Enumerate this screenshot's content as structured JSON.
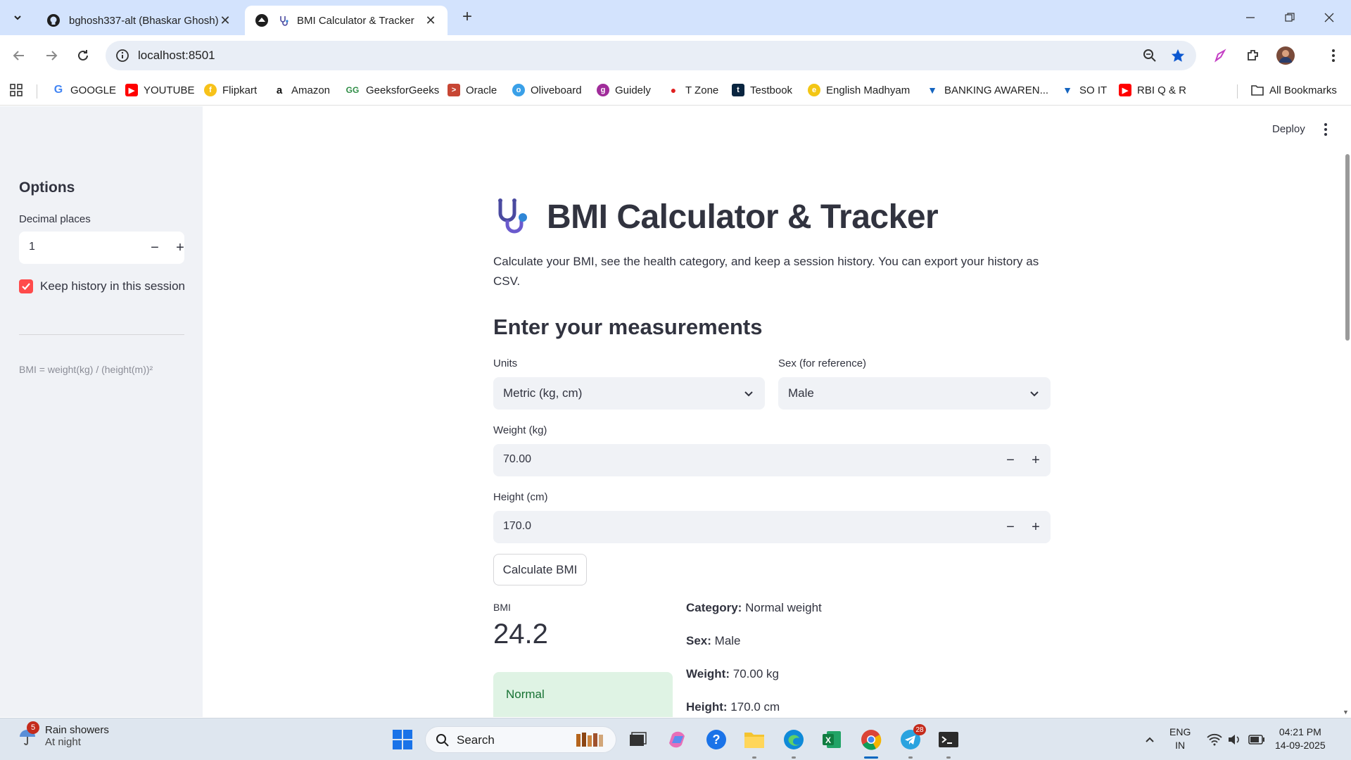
{
  "browser": {
    "tabs": [
      {
        "title": "bghosh337-alt (Bhaskar Ghosh)",
        "icon": "github-icon",
        "active": false
      },
      {
        "title": "BMI Calculator & Tracker",
        "icon": "stethoscope-icon",
        "active": true
      }
    ],
    "url": "localhost:8501",
    "bookmarks": [
      {
        "label": "GOOGLE",
        "icon": "google-icon"
      },
      {
        "label": "YOUTUBE",
        "icon": "youtube-icon"
      },
      {
        "label": "Flipkart",
        "icon": "flipkart-icon"
      },
      {
        "label": "Amazon",
        "icon": "amazon-icon"
      },
      {
        "label": "GeeksforGeeks",
        "icon": "gfg-icon"
      },
      {
        "label": "Oracle",
        "icon": "oracle-icon"
      },
      {
        "label": "Oliveboard",
        "icon": "oliveboard-icon"
      },
      {
        "label": "Guidely",
        "icon": "guidely-icon"
      },
      {
        "label": "T Zone",
        "icon": "tzone-icon"
      },
      {
        "label": "Testbook",
        "icon": "testbook-icon"
      },
      {
        "label": "English Madhyam",
        "icon": "english-madhyam-icon"
      },
      {
        "label": "BANKING AWAREN...",
        "icon": "banking-icon"
      },
      {
        "label": "SO IT",
        "icon": "soit-icon"
      },
      {
        "label": "RBI Q & R",
        "icon": "youtube-icon"
      }
    ],
    "all_bookmarks": "All Bookmarks"
  },
  "sidebar": {
    "title": "Options",
    "decimal_label": "Decimal places",
    "decimal_value": "1",
    "history_label": "Keep history in this session",
    "history_checked": true,
    "formula": "BMI = weight(kg) / (height(m))²"
  },
  "header": {
    "deploy": "Deploy"
  },
  "main": {
    "title": "BMI Calculator & Tracker",
    "intro": "Calculate your BMI, see the health category, and keep a session history. You can export your history as CSV.",
    "section_title": "Enter your measurements",
    "units_label": "Units",
    "units_value": "Metric (kg, cm)",
    "sex_label": "Sex (for reference)",
    "sex_value": "Male",
    "weight_label": "Weight (kg)",
    "weight_value": "70.00",
    "height_label": "Height (cm)",
    "height_value": "170.0",
    "calc_button": "Calculate BMI",
    "result": {
      "bmi_label": "BMI",
      "bmi_value": "24.2",
      "status": "Normal",
      "category_key": "Category:",
      "category_value": "Normal weight",
      "sex_key": "Sex:",
      "sex_value": "Male",
      "weight_key": "Weight:",
      "weight_value": "70.00 kg",
      "height_key": "Height:",
      "height_value": "170.0 cm"
    }
  },
  "taskbar": {
    "weather_badge": "5",
    "weather_line1": "Rain showers",
    "weather_line2": "At night",
    "search_label": "Search",
    "telegram_badge": "28",
    "lang_line1": "ENG",
    "lang_line2": "IN",
    "time": "04:21 PM",
    "date": "14-09-2025"
  },
  "colors": {
    "accent": "#ff4b4b",
    "sidebar_bg": "#f0f2f6",
    "success_bg": "#dff3e4",
    "success_text": "#177233"
  }
}
